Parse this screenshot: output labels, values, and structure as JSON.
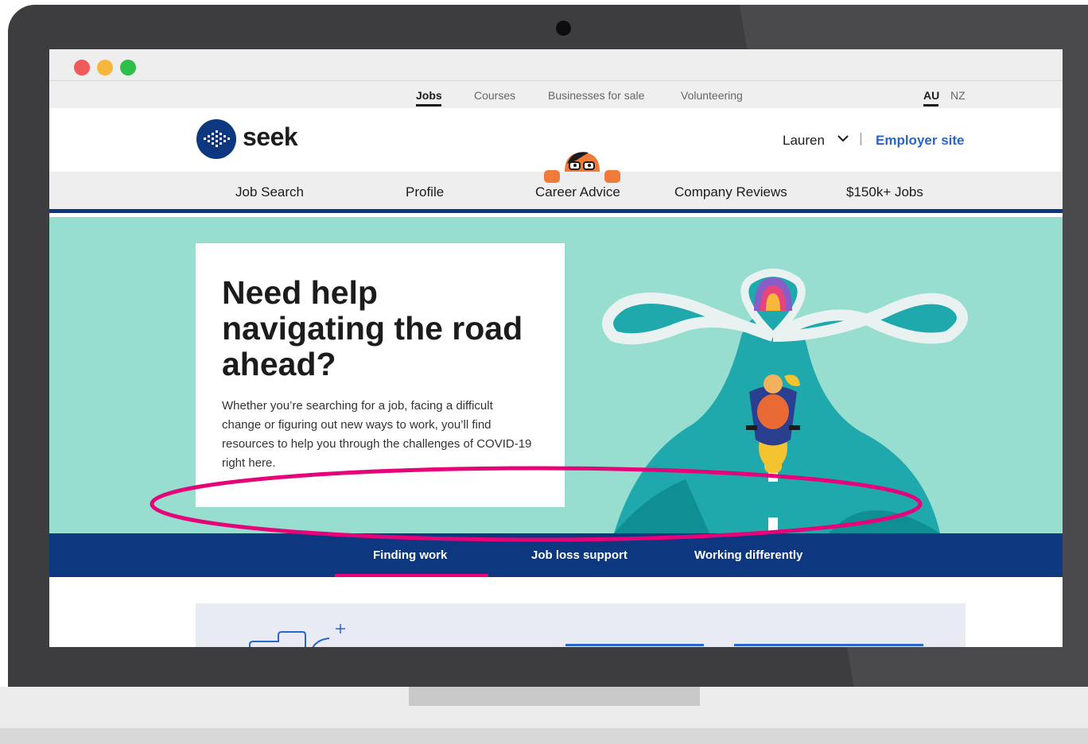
{
  "colors": {
    "brand_blue": "#0d3880",
    "link_blue": "#2765cf",
    "hero_teal": "#97ddd0",
    "highlight_pink": "#e60278",
    "laptop_grey": "#3d3d3f"
  },
  "top_nav": {
    "items": [
      "Jobs",
      "Courses",
      "Businesses for sale",
      "Volunteering"
    ],
    "active": "Jobs",
    "regions": [
      "AU",
      "NZ"
    ],
    "active_region": "AU"
  },
  "header": {
    "logo_text": "seek",
    "user_name": "Lauren",
    "employer_link": "Employer site"
  },
  "main_nav": {
    "items": [
      "Job Search",
      "Profile",
      "Career Advice",
      "Company Reviews",
      "$150k+ Jobs"
    ]
  },
  "hero": {
    "title": "Need help navigating the road ahead?",
    "body": "Whether you’re searching for a job, facing a difficult change or figuring out new ways to work, you’ll find resources to help you through the challenges of COVID-19 right here."
  },
  "tabs": {
    "items": [
      "Finding work",
      "Job loss support",
      "Working differently"
    ],
    "active": "Finding work"
  },
  "icons": {
    "user_menu": "chevron-down-icon",
    "logo": "seek-logo-icon",
    "mascot": "peeking-character-icon",
    "hero": "road-scooter-illustration",
    "lower": "briefcase-sparkle-icon"
  }
}
